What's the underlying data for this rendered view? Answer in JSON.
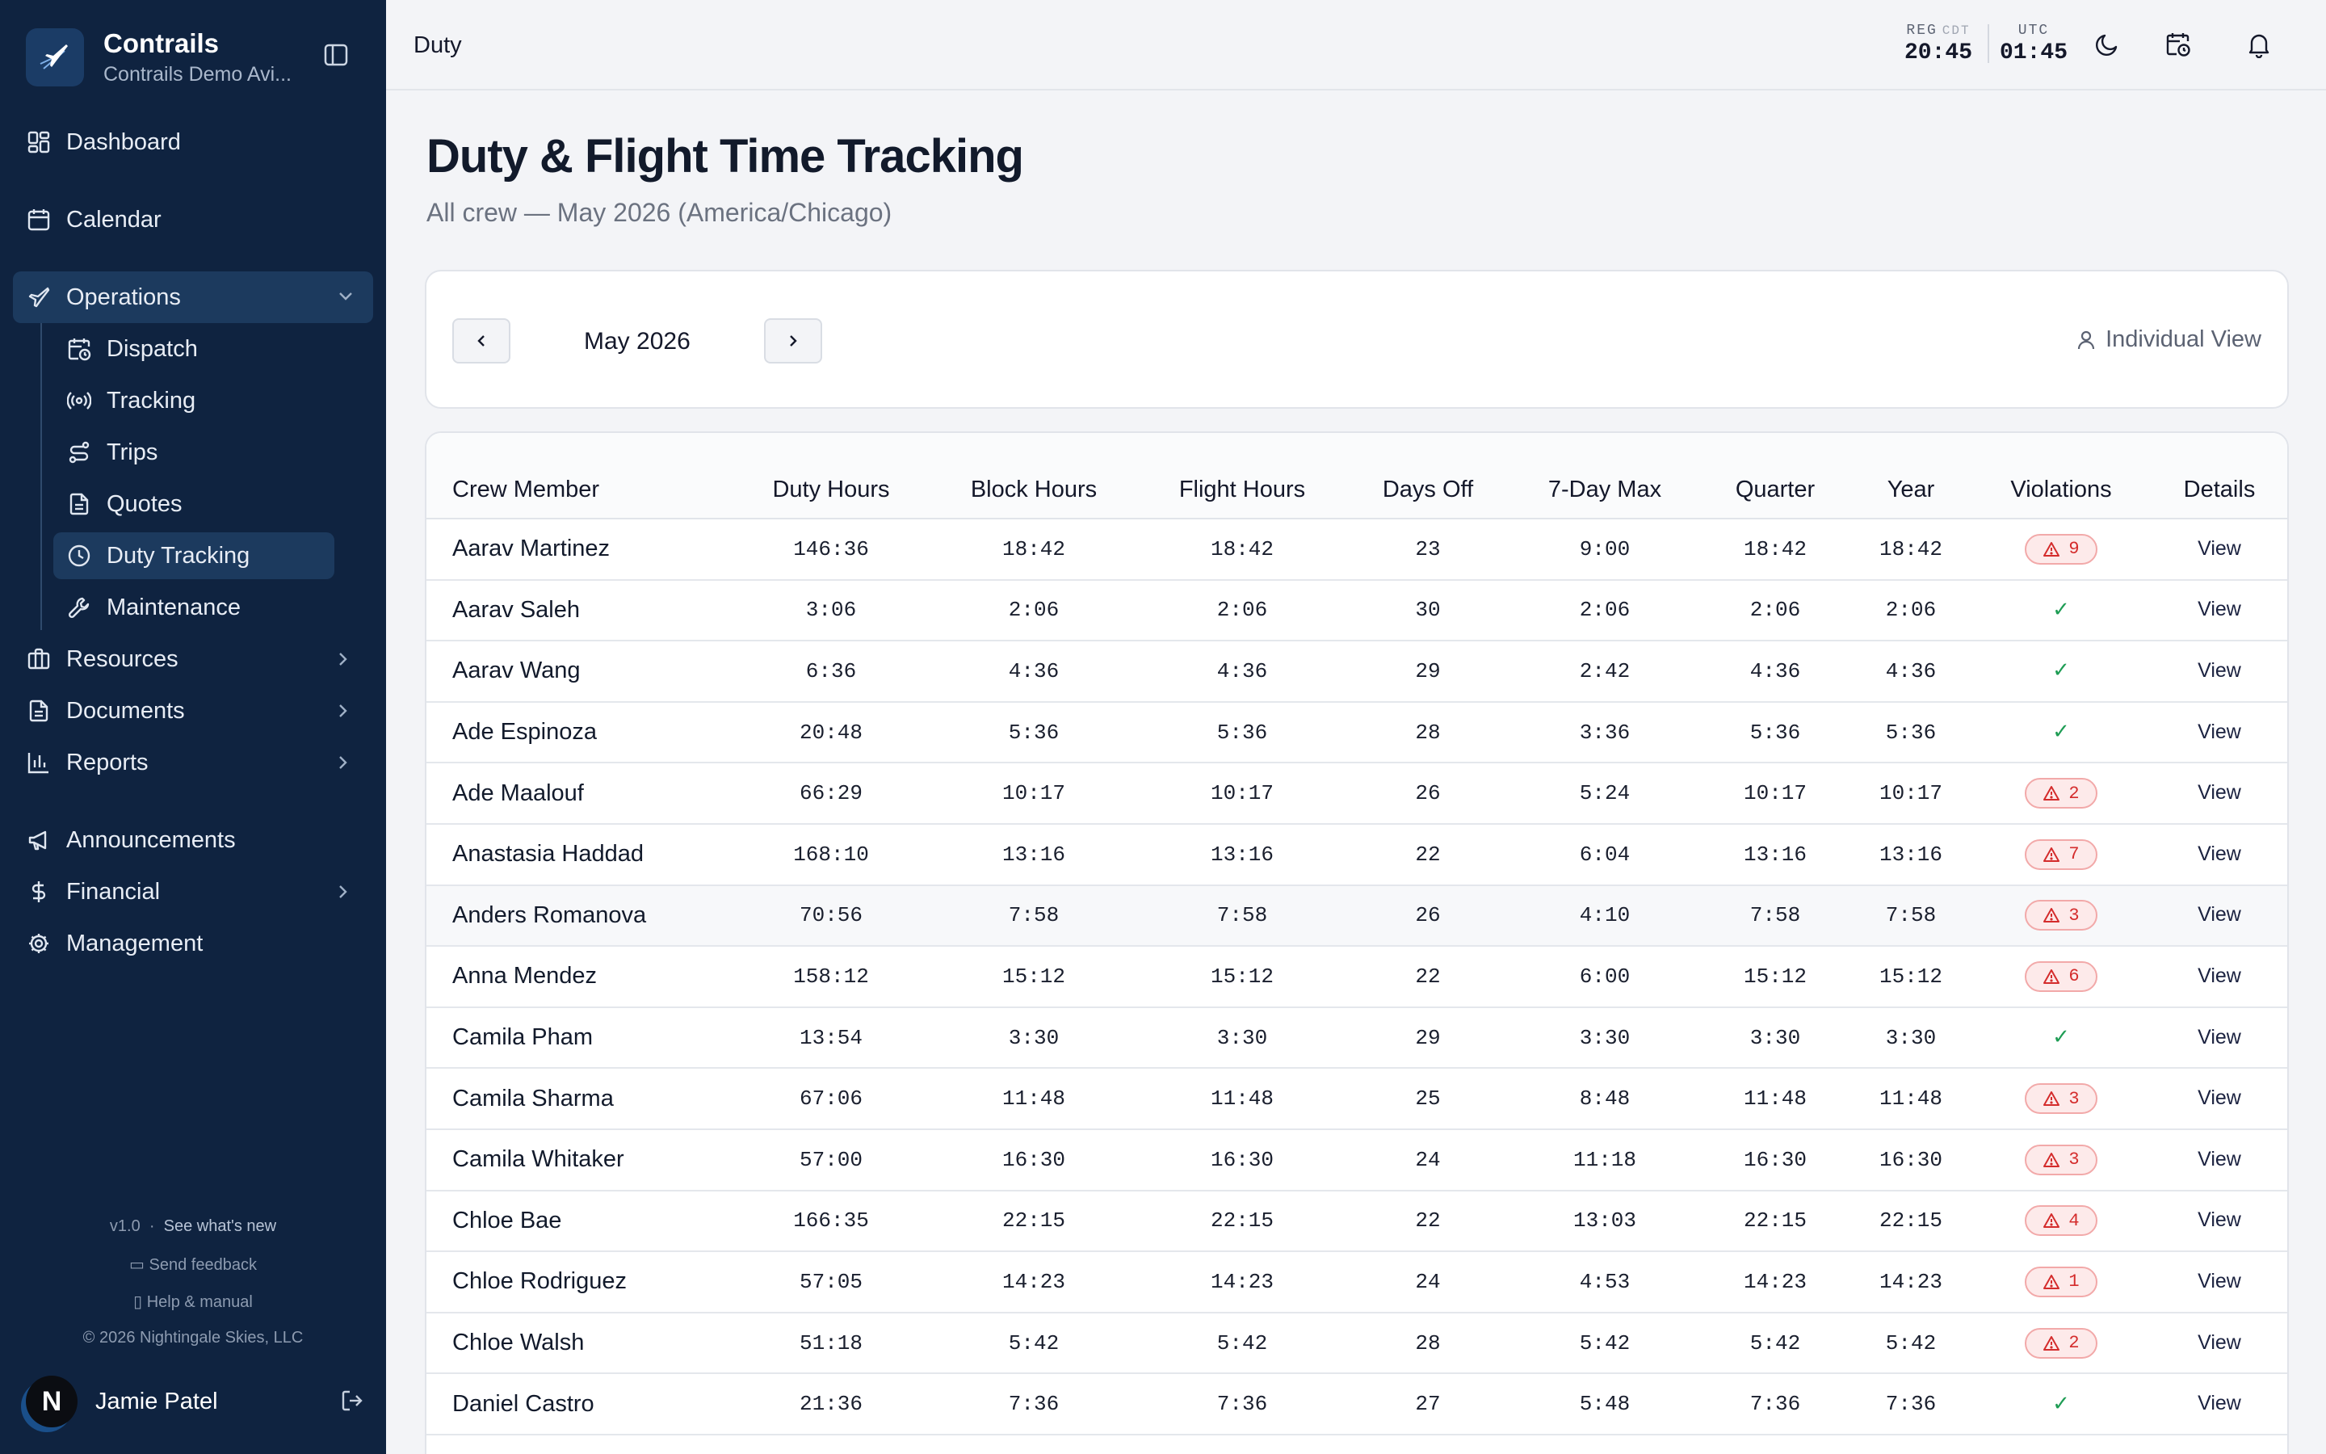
{
  "brand": {
    "name": "Contrails",
    "subtitle": "Contrails Demo Avi..."
  },
  "sidebar": {
    "items": [
      {
        "label": "Dashboard"
      },
      {
        "label": "Calendar"
      },
      {
        "label": "Operations"
      },
      {
        "label": "Dispatch"
      },
      {
        "label": "Tracking"
      },
      {
        "label": "Trips"
      },
      {
        "label": "Quotes"
      },
      {
        "label": "Duty Tracking"
      },
      {
        "label": "Maintenance"
      },
      {
        "label": "Resources"
      },
      {
        "label": "Documents"
      },
      {
        "label": "Reports"
      },
      {
        "label": "Announcements"
      },
      {
        "label": "Financial"
      },
      {
        "label": "Management"
      }
    ],
    "active": "Duty Tracking",
    "footer": {
      "version": "v1.0",
      "whats_new": "See what's new",
      "feedback": "Send feedback",
      "help": "Help & manual",
      "copyright": "© 2026 Nightingale Skies, LLC"
    },
    "user": {
      "initial": "N",
      "name": "Jamie Patel"
    }
  },
  "header": {
    "breadcrumb": "Duty",
    "clocks": [
      {
        "label": "REG",
        "zone": "CDT",
        "time": "20:45"
      },
      {
        "label": "UTC",
        "zone": "",
        "time": "01:45"
      }
    ]
  },
  "page": {
    "title": "Duty & Flight Time Tracking",
    "subtitle": "All crew — May 2026 (America/Chicago)",
    "month": "May 2026",
    "individual_view": "Individual View"
  },
  "table": {
    "columns": [
      "Crew Member",
      "Duty Hours",
      "Block Hours",
      "Flight Hours",
      "Days Off",
      "7-Day Max",
      "Quarter",
      "Year",
      "Violations",
      "Details"
    ],
    "view_label": "View",
    "ok_mark": "✓",
    "rows": [
      {
        "name": "Aarav Martinez",
        "duty": "146:36",
        "block": "18:42",
        "flight": "18:42",
        "days_off": "23",
        "max7": "9:00",
        "quarter": "18:42",
        "year": "18:42",
        "violations": "9"
      },
      {
        "name": "Aarav Saleh",
        "duty": "3:06",
        "block": "2:06",
        "flight": "2:06",
        "days_off": "30",
        "max7": "2:06",
        "quarter": "2:06",
        "year": "2:06",
        "violations": ""
      },
      {
        "name": "Aarav Wang",
        "duty": "6:36",
        "block": "4:36",
        "flight": "4:36",
        "days_off": "29",
        "max7": "2:42",
        "quarter": "4:36",
        "year": "4:36",
        "violations": ""
      },
      {
        "name": "Ade Espinoza",
        "duty": "20:48",
        "block": "5:36",
        "flight": "5:36",
        "days_off": "28",
        "max7": "3:36",
        "quarter": "5:36",
        "year": "5:36",
        "violations": ""
      },
      {
        "name": "Ade Maalouf",
        "duty": "66:29",
        "block": "10:17",
        "flight": "10:17",
        "days_off": "26",
        "max7": "5:24",
        "quarter": "10:17",
        "year": "10:17",
        "violations": "2"
      },
      {
        "name": "Anastasia Haddad",
        "duty": "168:10",
        "block": "13:16",
        "flight": "13:16",
        "days_off": "22",
        "max7": "6:04",
        "quarter": "13:16",
        "year": "13:16",
        "violations": "7"
      },
      {
        "name": "Anders Romanova",
        "duty": "70:56",
        "block": "7:58",
        "flight": "7:58",
        "days_off": "26",
        "max7": "4:10",
        "quarter": "7:58",
        "year": "7:58",
        "violations": "3"
      },
      {
        "name": "Anna Mendez",
        "duty": "158:12",
        "block": "15:12",
        "flight": "15:12",
        "days_off": "22",
        "max7": "6:00",
        "quarter": "15:12",
        "year": "15:12",
        "violations": "6"
      },
      {
        "name": "Camila Pham",
        "duty": "13:54",
        "block": "3:30",
        "flight": "3:30",
        "days_off": "29",
        "max7": "3:30",
        "quarter": "3:30",
        "year": "3:30",
        "violations": ""
      },
      {
        "name": "Camila Sharma",
        "duty": "67:06",
        "block": "11:48",
        "flight": "11:48",
        "days_off": "25",
        "max7": "8:48",
        "quarter": "11:48",
        "year": "11:48",
        "violations": "3"
      },
      {
        "name": "Camila Whitaker",
        "duty": "57:00",
        "block": "16:30",
        "flight": "16:30",
        "days_off": "24",
        "max7": "11:18",
        "quarter": "16:30",
        "year": "16:30",
        "violations": "3"
      },
      {
        "name": "Chloe Bae",
        "duty": "166:35",
        "block": "22:15",
        "flight": "22:15",
        "days_off": "22",
        "max7": "13:03",
        "quarter": "22:15",
        "year": "22:15",
        "violations": "4"
      },
      {
        "name": "Chloe Rodriguez",
        "duty": "57:05",
        "block": "14:23",
        "flight": "14:23",
        "days_off": "24",
        "max7": "4:53",
        "quarter": "14:23",
        "year": "14:23",
        "violations": "1"
      },
      {
        "name": "Chloe Walsh",
        "duty": "51:18",
        "block": "5:42",
        "flight": "5:42",
        "days_off": "28",
        "max7": "5:42",
        "quarter": "5:42",
        "year": "5:42",
        "violations": "2"
      },
      {
        "name": "Daniel Castro",
        "duty": "21:36",
        "block": "7:36",
        "flight": "7:36",
        "days_off": "27",
        "max7": "5:48",
        "quarter": "7:36",
        "year": "7:36",
        "violations": ""
      }
    ],
    "highlighted_row": "Anders Romanova"
  }
}
